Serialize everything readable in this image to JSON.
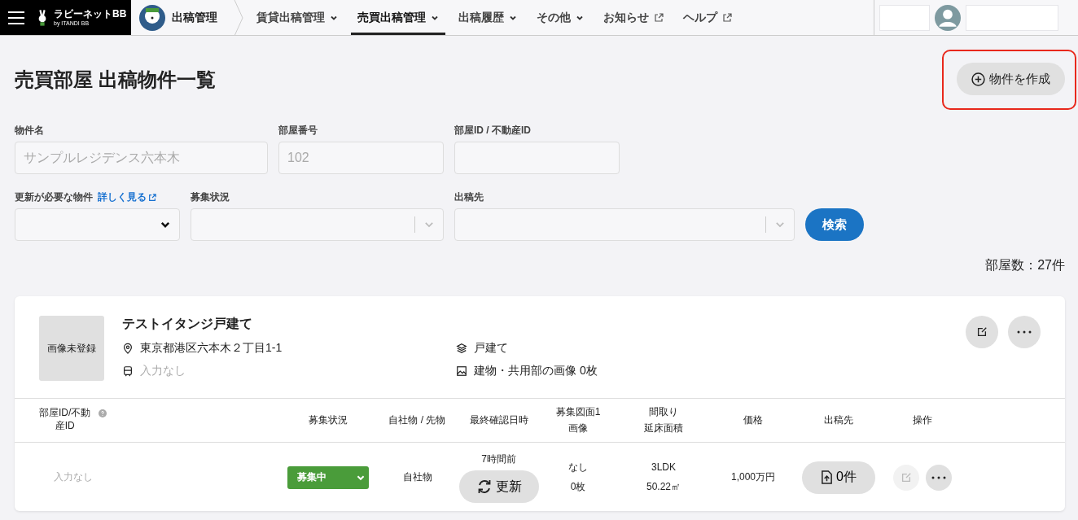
{
  "header": {
    "brand": "ラビーネットBB",
    "brand_sub": "by ITANDI BB",
    "app_title": "出稿管理",
    "nav": [
      {
        "label": "賃貸出稿管理",
        "kind": "dropdown",
        "selected": false
      },
      {
        "label": "売買出稿管理",
        "kind": "dropdown",
        "selected": true
      },
      {
        "label": "出稿履歴",
        "kind": "dropdown",
        "selected": false
      },
      {
        "label": "その他",
        "kind": "dropdown",
        "selected": false
      },
      {
        "label": "お知らせ",
        "kind": "external",
        "selected": false
      },
      {
        "label": "ヘルプ",
        "kind": "external",
        "selected": false
      }
    ]
  },
  "page": {
    "title": "売買部屋 出稿物件一覧",
    "create_button": {
      "label": "物件を作成",
      "highlighted": true
    }
  },
  "filters": {
    "property_name": {
      "label": "物件名",
      "placeholder": "サンプルレジデンス六本木"
    },
    "room_number": {
      "label": "部屋番号",
      "placeholder": "102"
    },
    "room_id": {
      "label": "部屋ID / 不動産ID"
    },
    "needs_update": {
      "label": "更新が必要な物件",
      "link": "詳しく見る"
    },
    "status": {
      "label": "募集状況"
    },
    "destination": {
      "label": "出稿先"
    },
    "search_button": "検索"
  },
  "count": "部屋数：27件",
  "property": {
    "thumbnail": "画像未登録",
    "name": "テストイタンジ戸建て",
    "address": "東京都港区六本木２丁目1-1",
    "station": "入力なし",
    "type": "戸建て",
    "images": "建物・共用部の画像 0枚",
    "columns": [
      [
        "部屋ID/不動",
        "産ID"
      ],
      [
        "募集状況"
      ],
      [
        "自社物 / 先物"
      ],
      [
        "最終確認日時"
      ],
      [
        "募集図面1",
        "画像"
      ],
      [
        "間取り",
        "延床面積"
      ],
      [
        "価格"
      ],
      [
        "出稿先"
      ],
      [
        "操作"
      ]
    ],
    "rows": [
      {
        "room_id": "入力なし",
        "status": "募集中",
        "ownership": "自社物",
        "last_checked": "7時間前",
        "update_button": "更新",
        "flyer": "なし",
        "image_count": "0枚",
        "layout": "3LDK",
        "area": "50.22㎡",
        "price": "1,000万円",
        "destinations": "0件",
        "edit_disabled": true
      }
    ]
  }
}
